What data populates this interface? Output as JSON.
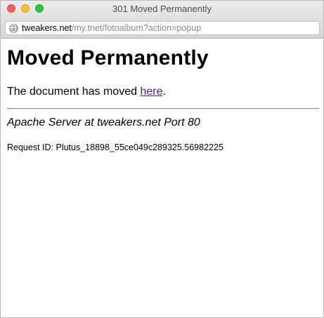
{
  "window": {
    "title": "301 Moved Permanently"
  },
  "urlbar": {
    "host": "tweakers.net",
    "path": "/my.tnet/fotoalbum?action=popup",
    "icon": "globe-icon"
  },
  "page": {
    "heading": "Moved Permanently",
    "message_prefix": "The document has moved ",
    "link_text": "here",
    "message_suffix": ".",
    "server_signature": "Apache Server at tweakers.net Port 80",
    "request_id": "Request ID: Plutus_18898_55ce049c289325.56982225"
  },
  "colors": {
    "link_visited": "#551a8b",
    "close": "#fc5f57",
    "minimize": "#fdbc2e",
    "zoom": "#28c840"
  }
}
